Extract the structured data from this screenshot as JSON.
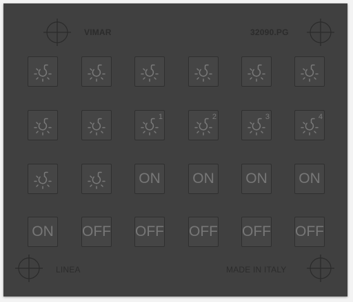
{
  "plate": {
    "brand": "VIMAR",
    "model": "32090.PG",
    "series": "LINEA",
    "origin": "MADE IN ITALY",
    "background_color": "#404040",
    "key_border_color": "#2f2f2f",
    "symbol_color": "#777777"
  },
  "rows": [
    {
      "keys": [
        {
          "type": "icon",
          "icon": "lamp-icon",
          "number": ""
        },
        {
          "type": "icon",
          "icon": "lamp-icon",
          "number": ""
        },
        {
          "type": "icon",
          "icon": "lamp-icon",
          "number": ""
        },
        {
          "type": "icon",
          "icon": "lamp-icon",
          "number": ""
        },
        {
          "type": "icon",
          "icon": "lamp-icon",
          "number": ""
        },
        {
          "type": "icon",
          "icon": "lamp-icon",
          "number": ""
        }
      ]
    },
    {
      "keys": [
        {
          "type": "icon",
          "icon": "lamp-icon",
          "number": ""
        },
        {
          "type": "icon",
          "icon": "lamp-icon",
          "number": ""
        },
        {
          "type": "icon",
          "icon": "lamp-icon",
          "number": "1"
        },
        {
          "type": "icon",
          "icon": "lamp-icon",
          "number": "2"
        },
        {
          "type": "icon",
          "icon": "lamp-icon",
          "number": "3"
        },
        {
          "type": "icon",
          "icon": "lamp-icon",
          "number": "4"
        }
      ]
    },
    {
      "keys": [
        {
          "type": "icon",
          "icon": "lamp-icon",
          "number": ""
        },
        {
          "type": "icon",
          "icon": "lamp-icon",
          "number": ""
        },
        {
          "type": "text",
          "label": "ON"
        },
        {
          "type": "text",
          "label": "ON"
        },
        {
          "type": "text",
          "label": "ON"
        },
        {
          "type": "text",
          "label": "ON"
        }
      ]
    },
    {
      "keys": [
        {
          "type": "text",
          "label": "ON"
        },
        {
          "type": "text",
          "label": "OFF"
        },
        {
          "type": "text",
          "label": "OFF"
        },
        {
          "type": "text",
          "label": "OFF"
        },
        {
          "type": "text",
          "label": "OFF"
        },
        {
          "type": "text",
          "label": "OFF"
        }
      ]
    }
  ]
}
